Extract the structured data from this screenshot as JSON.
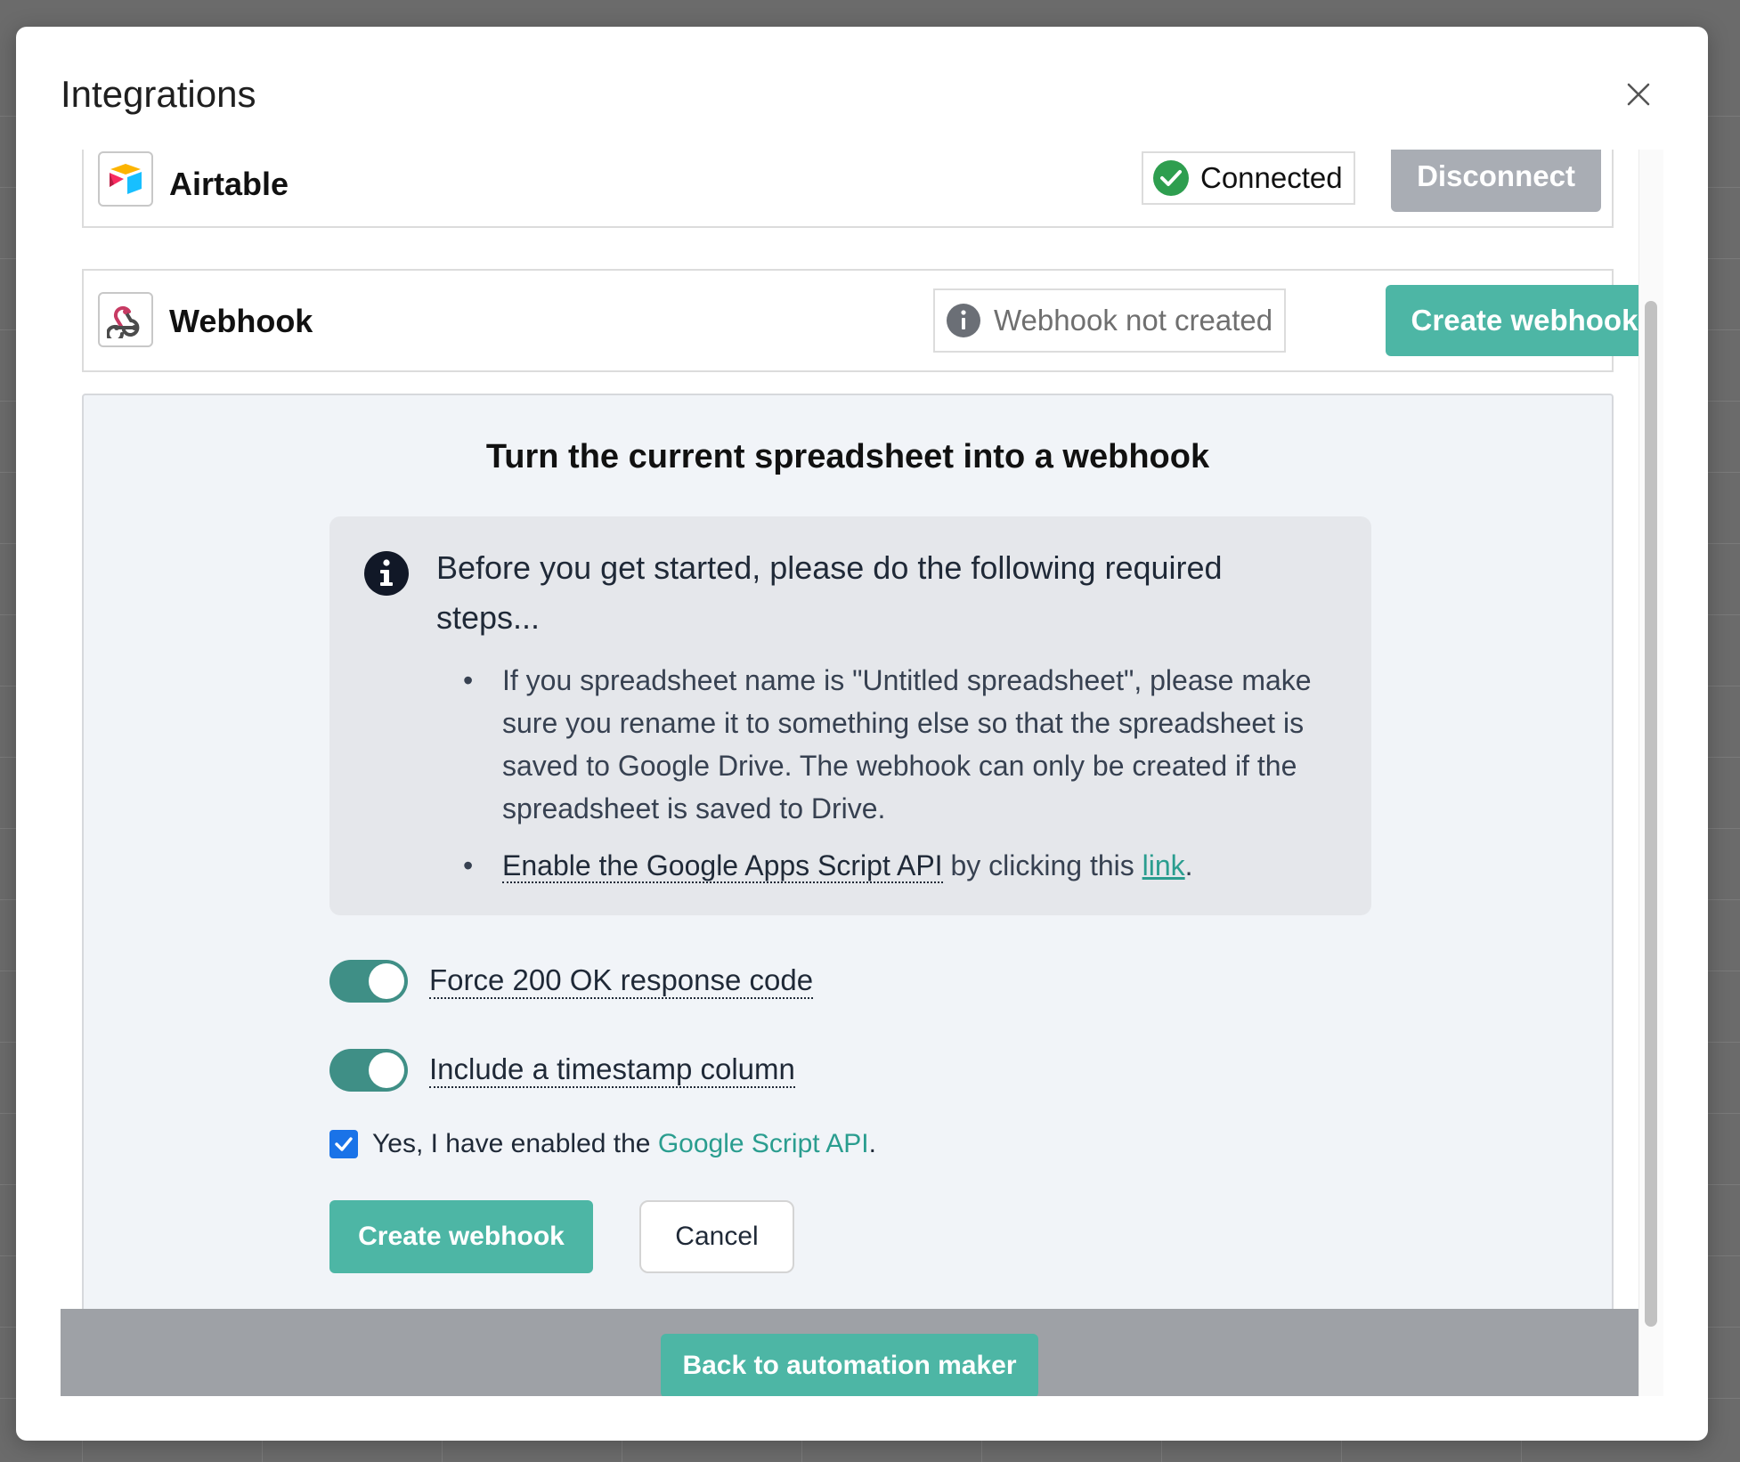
{
  "modal": {
    "title": "Integrations"
  },
  "integrations": {
    "airtable": {
      "name": "Airtable",
      "status": "Connected",
      "action_label": "Disconnect"
    },
    "webhook": {
      "name": "Webhook",
      "status": "Webhook not created",
      "action_label": "Create webhook"
    }
  },
  "panel": {
    "title": "Turn the current spreadsheet into a webhook",
    "info": {
      "heading": "Before you get started, please do the following required steps...",
      "step1": "If you spreadsheet name is \"Untitled spreadsheet\", please make sure you rename it to something else so that the spreadsheet is saved to Google Drive. The webhook can only be created if the spreadsheet is saved to Drive.",
      "step2_prefix": "Enable the Google Apps Script API",
      "step2_middle": " by clicking this ",
      "step2_link": "link",
      "step2_suffix": "."
    },
    "toggles": [
      {
        "label": "Force 200 OK response code",
        "on": true
      },
      {
        "label": "Include a timestamp column",
        "on": true
      }
    ],
    "confirm": {
      "prefix": "Yes, I have enabled the ",
      "link": "Google Script API",
      "suffix": ".",
      "checked": true
    },
    "create_label": "Create webhook",
    "cancel_label": "Cancel"
  },
  "footer": {
    "back_label": "Back to automation maker"
  },
  "colors": {
    "accent": "#4db6a5",
    "toggle_on": "#3f8f86",
    "checkbox": "#1a73e8",
    "disabled": "#a9adb4",
    "link": "#2a9d8f"
  },
  "icons": {
    "close": "close-icon",
    "airtable": "airtable-logo-icon",
    "webhook": "webhook-logo-icon",
    "connected": "check-circle-icon",
    "not_created": "info-circle-icon",
    "info": "info-icon"
  }
}
